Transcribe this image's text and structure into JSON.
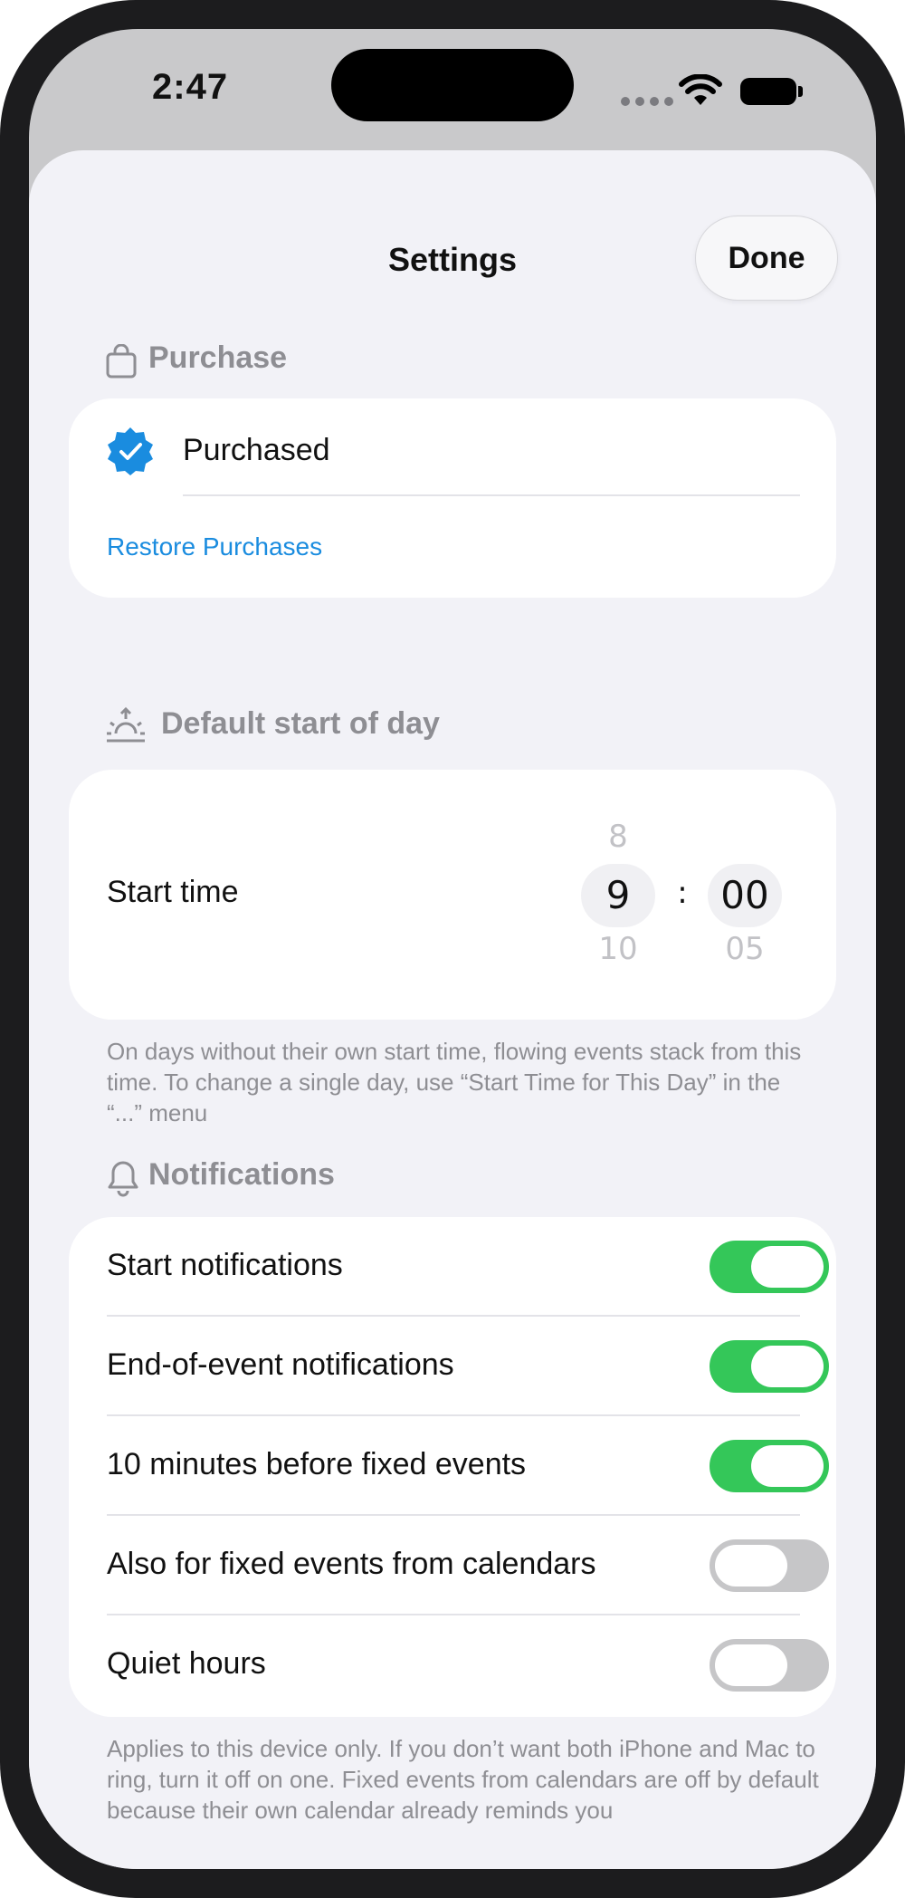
{
  "status_bar": {
    "time": "2:47"
  },
  "header": {
    "title": "Settings",
    "done_label": "Done"
  },
  "purchase": {
    "section_title": "Purchase",
    "status_label": "Purchased",
    "restore_label": "Restore Purchases"
  },
  "start_of_day": {
    "section_title": "Default start of day",
    "start_label": "Start time",
    "hour": {
      "above": "8",
      "selected": "9",
      "below": "10"
    },
    "separator": ":",
    "minute": {
      "above": "",
      "selected": "00",
      "below": "05"
    },
    "footnote": "On days without their own start time, flowing events stack from this time. To change a single day, use “Start Time for This Day” in the “...” menu"
  },
  "notifications": {
    "section_title": "Notifications",
    "items": [
      {
        "label": "Start notifications",
        "on": true
      },
      {
        "label": "End-of-event notifications",
        "on": true
      },
      {
        "label": "10 minutes before fixed events",
        "on": true
      },
      {
        "label": "Also for fixed events from calendars",
        "on": false
      },
      {
        "label": "Quiet hours",
        "on": false
      }
    ],
    "footnote": "Applies to this device only. If you don’t want both iPhone and Mac to ring, turn it off on one. Fixed events from calendars are off by default because their own calendar already reminds you"
  },
  "colors": {
    "accent_blue": "#1a8cdf",
    "toggle_on": "#34c759",
    "toggle_off": "#c6c6c8"
  }
}
